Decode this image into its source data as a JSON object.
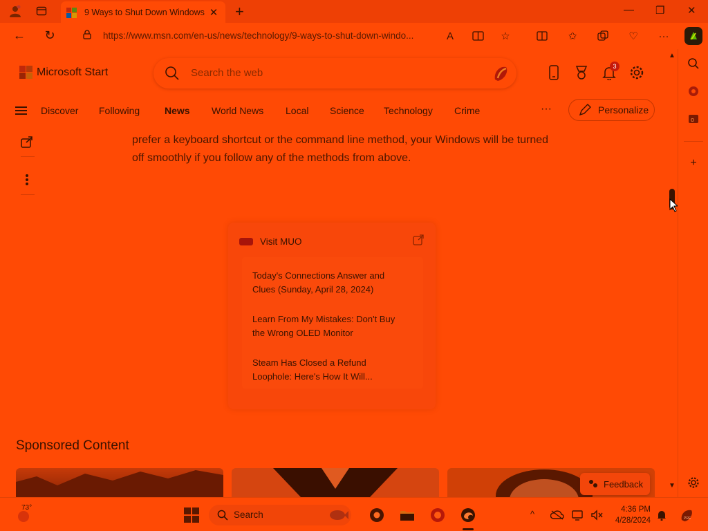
{
  "browser": {
    "tab_title": "9 Ways to Shut Down Windows",
    "url": "https://www.msn.com/en-us/news/technology/9-ways-to-shut-down-windo...",
    "window_controls": {
      "minimize": "—",
      "maximize": "❐",
      "close": "✕"
    }
  },
  "header": {
    "brand": "Microsoft Start",
    "search_placeholder": "Search the web",
    "notification_count": "3"
  },
  "nav": {
    "items": [
      "Discover",
      "Following",
      "News",
      "World News",
      "Local",
      "Science",
      "Technology",
      "Crime"
    ],
    "active": "News",
    "more": "···",
    "personalize_label": "Personalize"
  },
  "article": {
    "text": "prefer a keyboard shortcut or the command line method, your Windows will be turned off smoothly if you follow any of the methods from above."
  },
  "muo_card": {
    "title": "Visit MUO",
    "items": [
      "Today's Connections Answer and Clues (Sunday, April 28, 2024)",
      "Learn From My Mistakes: Don't Buy the Wrong OLED Monitor",
      "Steam Has Closed a Refund Loophole: Here's How It Will..."
    ]
  },
  "sponsored": {
    "heading": "Sponsored Content",
    "feedback_label": "Feedback"
  },
  "taskbar": {
    "weather_temp": "73°",
    "search_label": "Search",
    "time": "4:36 PM",
    "date": "4/28/2024"
  },
  "colors": {
    "background": "#ff4a05",
    "text": "#3a1200",
    "accent_dark": "#3a1200"
  }
}
